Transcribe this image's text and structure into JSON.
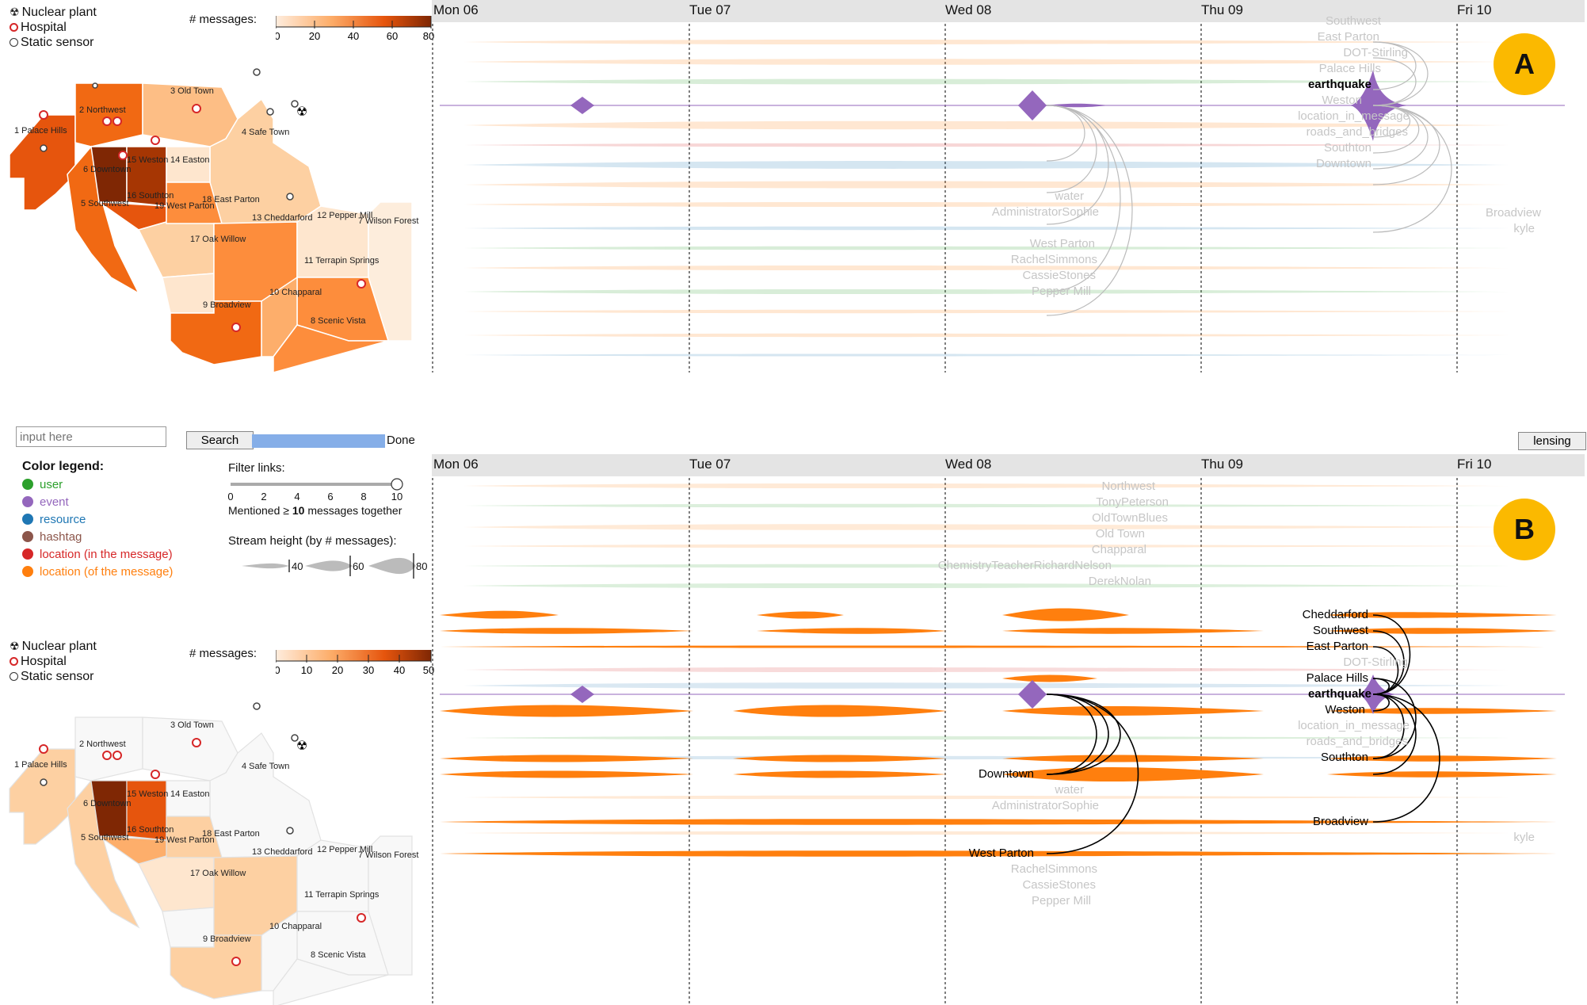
{
  "colors": {
    "user": "#2ca02c",
    "event": "#9467bd",
    "resource": "#1f77b4",
    "hashtag": "#8c564b",
    "location_in": "#d62728",
    "location_of": "#ff7f0e",
    "badge": "#fbb900"
  },
  "map_legend": {
    "nuclear": "Nuclear plant",
    "hospital": "Hospital",
    "sensor": "Static sensor",
    "nuclear_icon": "radiation-icon",
    "hospital_icon": "hospital-icon",
    "sensor_icon": "sensor-icon"
  },
  "colorbar_top": {
    "title": "# messages:",
    "ticks": [
      "0",
      "20",
      "40",
      "60",
      "80"
    ]
  },
  "colorbar_bottom": {
    "title": "# messages:",
    "ticks": [
      "0",
      "10",
      "20",
      "30",
      "40",
      "50"
    ]
  },
  "regions": [
    "1 Palace Hills",
    "2 Northwest",
    "3 Old Town",
    "4 Safe Town",
    "5 Southwest",
    "6 Downtown",
    "7 Wilson Forest",
    "8 Scenic Vista",
    "9 Broadview",
    "10 Chapparal",
    "11 Terrapin Springs",
    "12 Pepper Mill",
    "13 Cheddarford",
    "14 Easton",
    "15 Weston",
    "16 Southton",
    "17 Oak Willow",
    "18 East Parton",
    "19 West Parton"
  ],
  "days": [
    "Mon 06",
    "Tue 07",
    "Wed 08",
    "Thu 09",
    "Fri 10"
  ],
  "badges": {
    "a": "A",
    "b": "B"
  },
  "panel_a_labels": [
    "Southwest",
    "East Parton",
    "DOT-Stirling",
    "Palace Hills",
    "earthquake",
    "Weston",
    "location_in_message",
    "roads_and_bridges",
    "Southton",
    "Downtown",
    "water",
    "AdministratorSophie",
    "Broadview",
    "kyle",
    "West Parton",
    "RachelSimmons",
    "CassieStones",
    "Pepper Mill"
  ],
  "panel_b_labels": [
    "Northwest",
    "TonyPeterson",
    "OldTownBlues",
    "Old Town",
    "Chapparal",
    "ChemistryTeacherRichardNelson",
    "DerekNolan",
    "Cheddarford",
    "Southwest",
    "East Parton",
    "DOT-Stirling",
    "Palace Hills",
    "earthquake",
    "Weston",
    "location_in_message",
    "roads_and_bridges",
    "Southton",
    "Downtown",
    "water",
    "AdministratorSophie",
    "Broadview",
    "kyle",
    "West Parton",
    "RachelSimmons",
    "CassieStones",
    "Pepper Mill"
  ],
  "controls": {
    "search_placeholder": "input here",
    "search_label": "Search",
    "done_label": "Done",
    "lensing_label": "lensing",
    "filter_label": "Filter links:",
    "filter_ticks": [
      "0",
      "2",
      "4",
      "6",
      "8",
      "10"
    ],
    "filter_value": 10,
    "mentioned_prefix": "Mentioned ≥",
    "mentioned_value": "10",
    "mentioned_suffix": "messages together",
    "stream_height_label": "Stream height (by # messages):",
    "stream_heights": [
      "40",
      "60",
      "80"
    ],
    "progress_fraction": 1.0
  },
  "color_legend": {
    "title": "Color legend:",
    "items": [
      "user",
      "event",
      "resource",
      "hashtag",
      "location (in the message)",
      "location (of the message)"
    ]
  }
}
